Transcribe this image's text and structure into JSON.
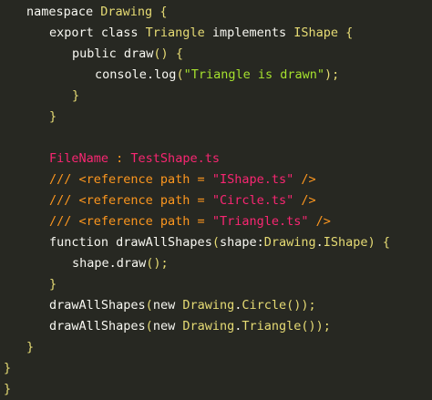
{
  "editor": {
    "lines": [
      {
        "indent": 1,
        "tokens": [
          {
            "t": "namespace ",
            "k": "kw"
          },
          {
            "t": "Drawing",
            "k": "type"
          },
          {
            "t": " ",
            "k": "plain"
          },
          {
            "t": "{",
            "k": "brace"
          }
        ]
      },
      {
        "indent": 2,
        "tokens": [
          {
            "t": "export class ",
            "k": "kw"
          },
          {
            "t": "Triangle",
            "k": "type"
          },
          {
            "t": " implements ",
            "k": "kw"
          },
          {
            "t": "IShape",
            "k": "type"
          },
          {
            "t": " ",
            "k": "plain"
          },
          {
            "t": "{",
            "k": "brace"
          }
        ]
      },
      {
        "indent": 3,
        "tokens": [
          {
            "t": "public ",
            "k": "kw"
          },
          {
            "t": "draw",
            "k": "fname"
          },
          {
            "t": "()",
            "k": "paren"
          },
          {
            "t": " ",
            "k": "plain"
          },
          {
            "t": "{",
            "k": "brace"
          }
        ]
      },
      {
        "indent": 4,
        "tokens": [
          {
            "t": "console",
            "k": "ident"
          },
          {
            "t": ".",
            "k": "punct"
          },
          {
            "t": "log",
            "k": "fname"
          },
          {
            "t": "(",
            "k": "paren"
          },
          {
            "t": "\"Triangle is drawn\"",
            "k": "string"
          },
          {
            "t": ");",
            "k": "paren"
          }
        ]
      },
      {
        "indent": 3,
        "tokens": [
          {
            "t": "}",
            "k": "brace"
          }
        ]
      },
      {
        "indent": 2,
        "tokens": [
          {
            "t": "}",
            "k": "brace"
          }
        ]
      },
      {
        "indent": 0,
        "tokens": []
      },
      {
        "indent": 2,
        "tokens": [
          {
            "t": "FileName",
            "k": "label"
          },
          {
            "t": " : ",
            "k": "comment"
          },
          {
            "t": "TestShape.ts",
            "k": "label"
          }
        ]
      },
      {
        "indent": 2,
        "tokens": [
          {
            "t": "/// <reference path = ",
            "k": "comment"
          },
          {
            "t": "\"IShape.ts\"",
            "k": "label"
          },
          {
            "t": " />",
            "k": "comment"
          }
        ]
      },
      {
        "indent": 2,
        "tokens": [
          {
            "t": "/// <reference path = ",
            "k": "comment"
          },
          {
            "t": "\"Circle.ts\"",
            "k": "label"
          },
          {
            "t": " />",
            "k": "comment"
          }
        ]
      },
      {
        "indent": 2,
        "tokens": [
          {
            "t": "/// <reference path = ",
            "k": "comment"
          },
          {
            "t": "\"Triangle.ts\"",
            "k": "label"
          },
          {
            "t": " />",
            "k": "comment"
          }
        ]
      },
      {
        "indent": 2,
        "tokens": [
          {
            "t": "function ",
            "k": "kw"
          },
          {
            "t": "drawAllShapes",
            "k": "fname"
          },
          {
            "t": "(",
            "k": "paren"
          },
          {
            "t": "shape",
            "k": "ident"
          },
          {
            "t": ":",
            "k": "punct"
          },
          {
            "t": "Drawing",
            "k": "type"
          },
          {
            "t": ".",
            "k": "punct"
          },
          {
            "t": "IShape",
            "k": "type"
          },
          {
            "t": ")",
            "k": "paren"
          },
          {
            "t": " ",
            "k": "plain"
          },
          {
            "t": "{",
            "k": "brace"
          }
        ]
      },
      {
        "indent": 3,
        "tokens": [
          {
            "t": "shape",
            "k": "ident"
          },
          {
            "t": ".",
            "k": "punct"
          },
          {
            "t": "draw",
            "k": "fname"
          },
          {
            "t": "();",
            "k": "paren"
          }
        ]
      },
      {
        "indent": 2,
        "tokens": [
          {
            "t": "}",
            "k": "brace"
          }
        ]
      },
      {
        "indent": 2,
        "tokens": [
          {
            "t": "drawAllShapes",
            "k": "fname"
          },
          {
            "t": "(",
            "k": "paren"
          },
          {
            "t": "new ",
            "k": "kw"
          },
          {
            "t": "Drawing",
            "k": "type"
          },
          {
            "t": ".",
            "k": "punct"
          },
          {
            "t": "Circle",
            "k": "type"
          },
          {
            "t": "());",
            "k": "paren"
          }
        ]
      },
      {
        "indent": 2,
        "tokens": [
          {
            "t": "drawAllShapes",
            "k": "fname"
          },
          {
            "t": "(",
            "k": "paren"
          },
          {
            "t": "new ",
            "k": "kw"
          },
          {
            "t": "Drawing",
            "k": "type"
          },
          {
            "t": ".",
            "k": "punct"
          },
          {
            "t": "Triangle",
            "k": "type"
          },
          {
            "t": "());",
            "k": "paren"
          }
        ]
      },
      {
        "indent": 1,
        "tokens": [
          {
            "t": "}",
            "k": "brace"
          }
        ]
      },
      {
        "indent": 0,
        "tokens": [
          {
            "t": "}",
            "k": "brace"
          }
        ]
      },
      {
        "indent": 0,
        "tokens": [
          {
            "t": "}",
            "k": "brace"
          }
        ]
      }
    ]
  }
}
